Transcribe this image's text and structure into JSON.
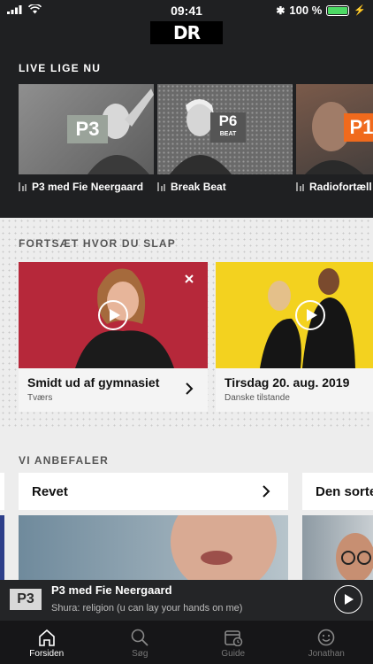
{
  "status": {
    "time": "09:41",
    "battery": "100 %",
    "battery_level": 1.0
  },
  "header": {
    "logo": "DR"
  },
  "live": {
    "title": "LIVE LIGE NU",
    "items": [
      {
        "channel": "P3",
        "channel_sub": "",
        "label": "P3 med Fie Neergaard"
      },
      {
        "channel": "P6",
        "channel_sub": "BEAT",
        "label": "Break Beat"
      },
      {
        "channel": "P1",
        "channel_sub": "",
        "label": "Radiofortæll"
      }
    ]
  },
  "continue": {
    "title": "FORTSÆT HVOR DU SLAP",
    "items": [
      {
        "title": "Smidt ud af gymnasiet",
        "subtitle": "Tværs"
      },
      {
        "title": "Tirsdag 20. aug. 2019",
        "subtitle": "Danske tilstande"
      }
    ]
  },
  "recommend": {
    "title": "VI ANBEFALER",
    "items": [
      {
        "title": "Revet"
      },
      {
        "title": "Den sorte"
      }
    ]
  },
  "player": {
    "badge": "P3",
    "title": "P3 med Fie Neergaard",
    "subtitle": "Shura: religion (u can lay your hands on me)"
  },
  "tabs": [
    {
      "label": "Forsiden",
      "icon": "home-icon"
    },
    {
      "label": "Søg",
      "icon": "search-icon"
    },
    {
      "label": "Guide",
      "icon": "calendar-clock-icon"
    },
    {
      "label": "Jonathan",
      "icon": "smiley-icon"
    }
  ],
  "colors": {
    "p1_orange": "#f06a1d",
    "continue_red": "#b6283a",
    "continue_yellow": "#f3d21f"
  }
}
